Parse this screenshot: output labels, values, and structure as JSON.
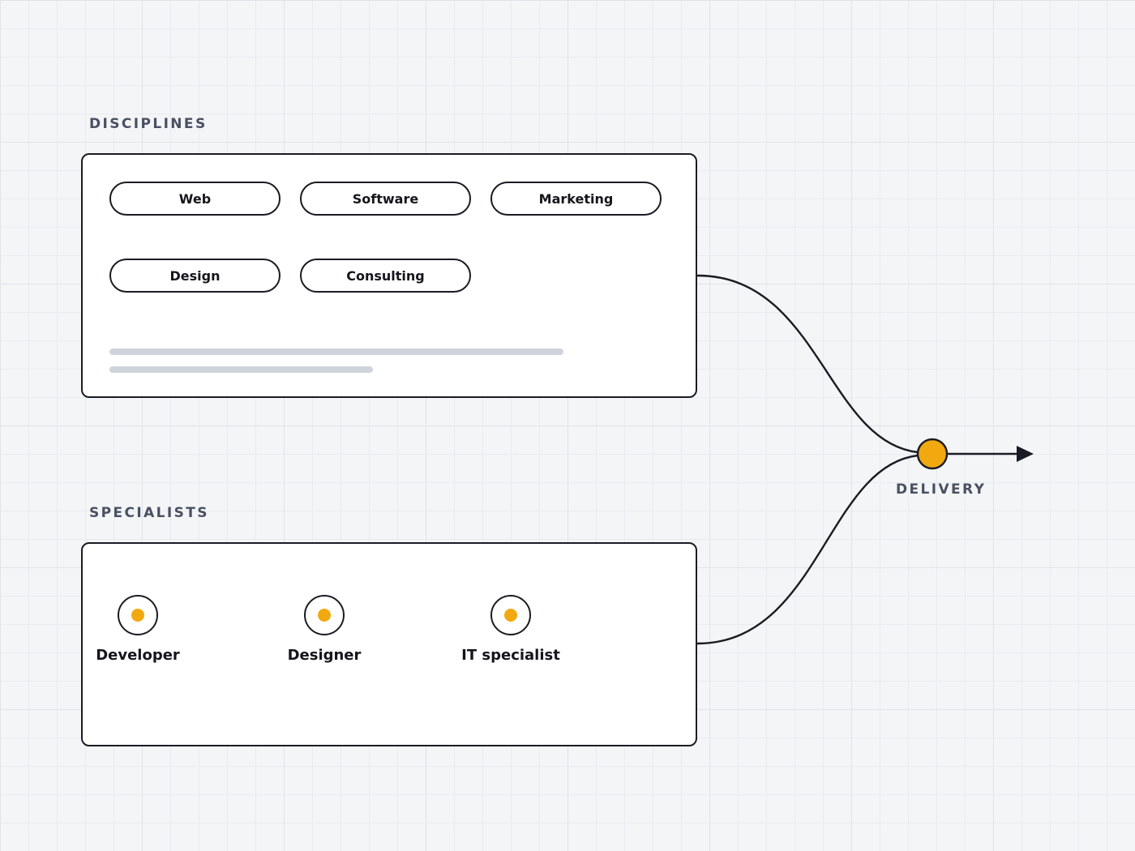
{
  "disciplines": {
    "title": "DISCIPLINES",
    "items": [
      "Web",
      "Software",
      "Marketing",
      "Design",
      "Consulting"
    ]
  },
  "specialists": {
    "title": "SPECIALISTS",
    "items": [
      "Developer",
      "Designer",
      "IT specialist"
    ]
  },
  "delivery": {
    "label": "DELIVERY"
  },
  "colors": {
    "accent": "#f2a90f",
    "stroke": "#1a1c24",
    "label": "#4a5062",
    "skeleton": "#cfd4dc",
    "panel": "#ffffff",
    "background": "#f3f5f7"
  }
}
